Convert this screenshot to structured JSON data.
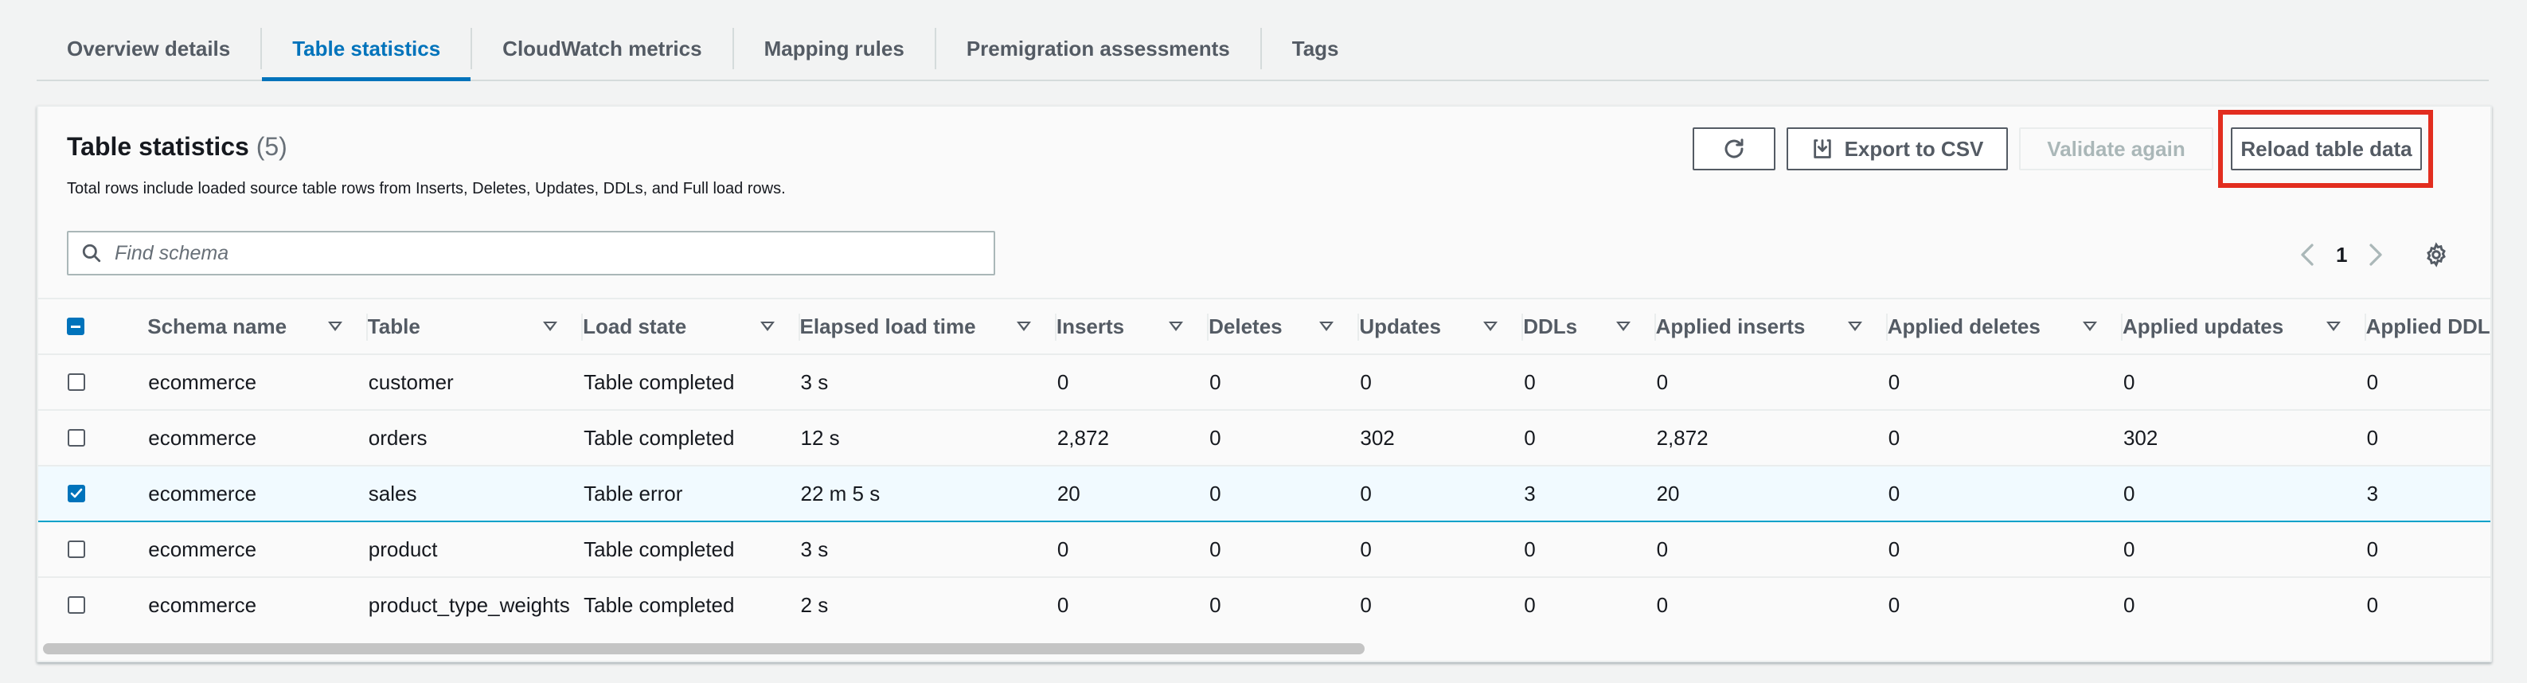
{
  "tabs": [
    {
      "label": "Overview details",
      "active": false
    },
    {
      "label": "Table statistics",
      "active": true
    },
    {
      "label": "CloudWatch metrics",
      "active": false
    },
    {
      "label": "Mapping rules",
      "active": false
    },
    {
      "label": "Premigration assessments",
      "active": false
    },
    {
      "label": "Tags",
      "active": false
    }
  ],
  "panel": {
    "title": "Table statistics",
    "count": "(5)",
    "description": "Total rows include loaded source table rows from Inserts, Deletes, Updates, DDLs, and Full load rows."
  },
  "actions": {
    "refresh_icon": "refresh-icon",
    "export_label": "Export to CSV",
    "export_icon": "download-icon",
    "validate_label": "Validate again",
    "reload_label": "Reload table data",
    "highlight_color": "#e22d1f"
  },
  "search": {
    "placeholder": "Find schema",
    "value": ""
  },
  "pagination": {
    "page": "1"
  },
  "table": {
    "columns": [
      "Schema name",
      "Table",
      "Load state",
      "Elapsed load time",
      "Inserts",
      "Deletes",
      "Updates",
      "DDLs",
      "Applied inserts",
      "Applied deletes",
      "Applied updates",
      "Applied DDLs"
    ],
    "rows": [
      {
        "selected": false,
        "cells": [
          "ecommerce",
          "customer",
          "Table completed",
          "3 s",
          "0",
          "0",
          "0",
          "0",
          "0",
          "0",
          "0",
          "0"
        ]
      },
      {
        "selected": false,
        "cells": [
          "ecommerce",
          "orders",
          "Table completed",
          "12 s",
          "2,872",
          "0",
          "302",
          "0",
          "2,872",
          "0",
          "302",
          "0"
        ]
      },
      {
        "selected": true,
        "cells": [
          "ecommerce",
          "sales",
          "Table error",
          "22 m 5 s",
          "20",
          "0",
          "0",
          "3",
          "20",
          "0",
          "0",
          "3"
        ]
      },
      {
        "selected": false,
        "cells": [
          "ecommerce",
          "product",
          "Table completed",
          "3 s",
          "0",
          "0",
          "0",
          "0",
          "0",
          "0",
          "0",
          "0"
        ]
      },
      {
        "selected": false,
        "cells": [
          "ecommerce",
          "product_type_weights",
          "Table completed",
          "2 s",
          "0",
          "0",
          "0",
          "0",
          "0",
          "0",
          "0",
          "0"
        ]
      }
    ]
  },
  "colors": {
    "accent": "#0073bb",
    "selected_row": "#f1faff",
    "selected_border": "#00a1c9"
  }
}
